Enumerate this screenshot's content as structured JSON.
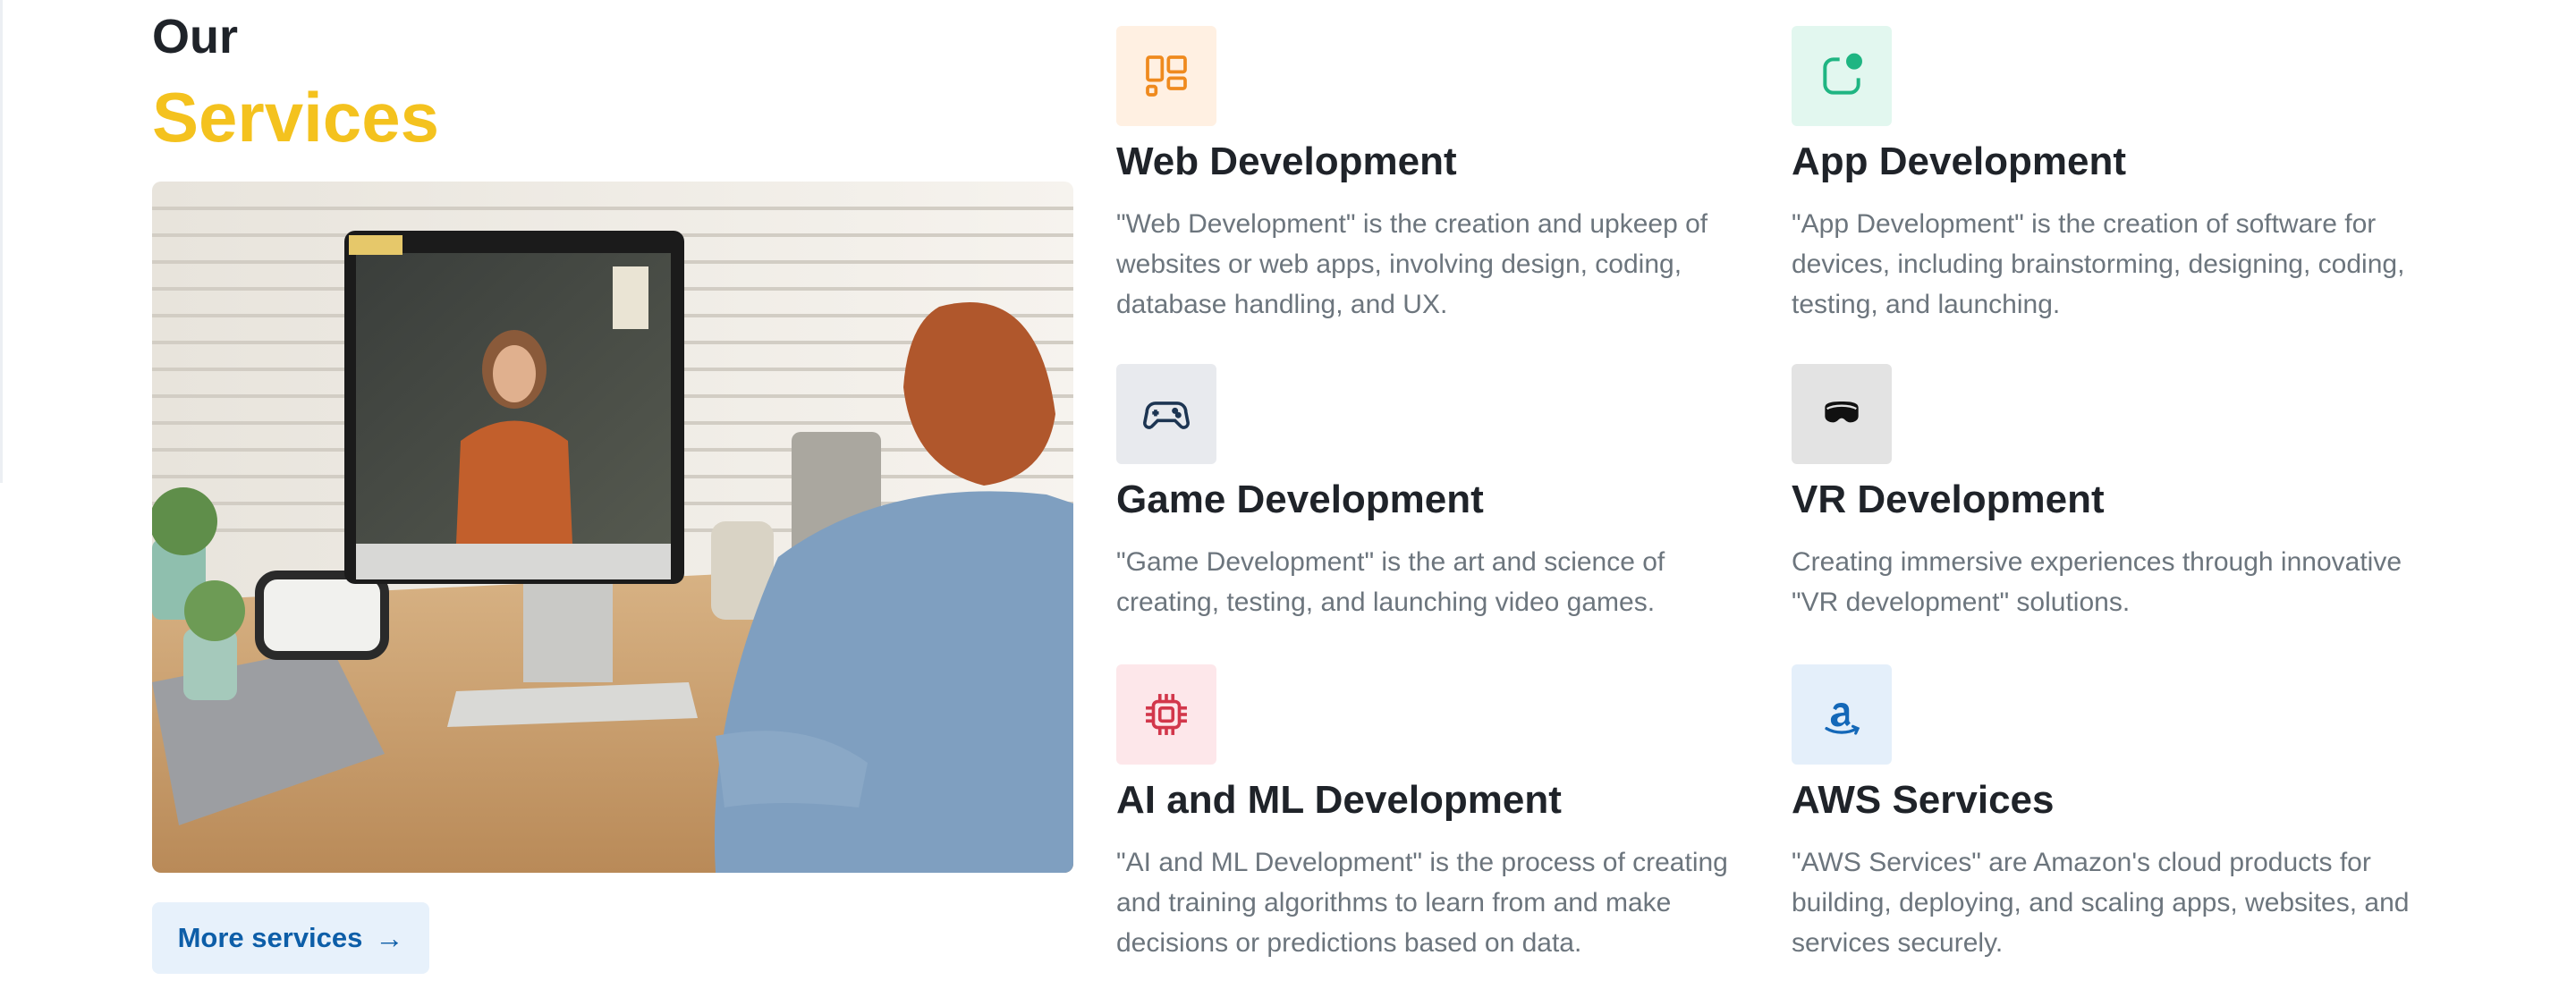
{
  "heading": {
    "line1": "Our",
    "line2": "Services"
  },
  "more_button": {
    "label": "More services",
    "arrow": "→"
  },
  "services": [
    {
      "title": "Web Development",
      "desc": "\"Web Development\" is the creation and upkeep of websites or web apps, involving design, coding, database handling, and UX.",
      "icon": "layout-icon",
      "icon_bg": "#fff0e2",
      "icon_color": "#ef8a1e"
    },
    {
      "title": "App Development",
      "desc": "\"App Development\" is the creation of software for devices, including brainstorming, designing, coding, testing, and launching.",
      "icon": "app-notification-icon",
      "icon_bg": "#e2f7ef",
      "icon_color": "#1fb582"
    },
    {
      "title": "Game Development",
      "desc": "\"Game Development\" is the art and science of creating, testing, and launching video games.",
      "icon": "gamepad-icon",
      "icon_bg": "#e8eaee",
      "icon_color": "#1d3552"
    },
    {
      "title": "VR Development",
      "desc": "Creating immersive experiences through innovative \"VR development\" solutions.",
      "icon": "vr-headset-icon",
      "icon_bg": "#e3e3e3",
      "icon_color": "#111111"
    },
    {
      "title": "AI and ML Development",
      "desc": "\"AI and ML Development\" is the process of creating and training algorithms to learn from and make decisions or predictions based on data.",
      "icon": "cpu-chip-icon",
      "icon_bg": "#fde7ea",
      "icon_color": "#d2374b"
    },
    {
      "title": "AWS Services",
      "desc": "\"AWS Services\" are Amazon's cloud products for building, deploying, and scaling apps, websites, and services securely.",
      "icon": "amazon-icon",
      "icon_bg": "#e4effa",
      "icon_color": "#1468b8"
    }
  ]
}
